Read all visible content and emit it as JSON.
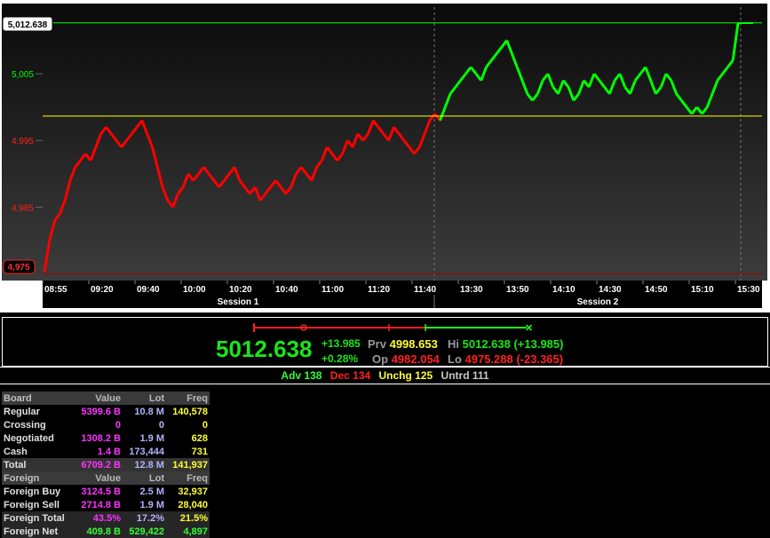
{
  "chart_data": {
    "type": "line",
    "title": "",
    "xlabel": "",
    "ylabel": "",
    "ylim": [
      4974,
      5015
    ],
    "y_ticks": [
      "5,005",
      "4,995",
      "4,985"
    ],
    "x_ticks": [
      "08:55",
      "09:20",
      "09:40",
      "10:00",
      "10:20",
      "10:40",
      "11:00",
      "11:20",
      "11:40",
      "13:30",
      "13:50",
      "14:10",
      "14:30",
      "14:50",
      "15:10",
      "15:30"
    ],
    "sessions": [
      "Session 1",
      "Session 2"
    ],
    "current_value_label": "5,012.638",
    "current_value": 5012.638,
    "low_value_label": "4,975",
    "previous_close": 4998.653,
    "previous_close_color": "#ffff00",
    "up_color": "#00ff00",
    "down_color": "#ff0000",
    "series": [
      {
        "values": [
          4975.3,
          4980,
          4983,
          4984,
          4986,
          4989,
          4991,
          4992,
          4993,
          4992,
          4994,
          4996,
          4997,
          4996,
          4995,
          4994,
          4995,
          4996,
          4997,
          4998,
          4996,
          4994,
          4991,
          4988,
          4986,
          4985,
          4987,
          4988,
          4990,
          4989,
          4990,
          4991,
          4990,
          4989,
          4988,
          4989,
          4990,
          4991,
          4989,
          4988,
          4987,
          4988,
          4986,
          4987,
          4988,
          4989,
          4988,
          4987,
          4988,
          4990,
          4991,
          4990,
          4989,
          4991,
          4992,
          4994,
          4993,
          4992,
          4993,
          4995,
          4994,
          4996,
          4995,
          4996,
          4998,
          4997,
          4996,
          4995,
          4997,
          4996,
          4995,
          4994,
          4993,
          4994,
          4996,
          4998,
          4999,
          4998,
          5000,
          5002,
          5003,
          5004,
          5005,
          5006,
          5005,
          5004,
          5006,
          5007,
          5008,
          5009,
          5010,
          5008,
          5006,
          5004,
          5002,
          5001,
          5002,
          5004,
          5005,
          5003,
          5002,
          5004,
          5003,
          5001,
          5002,
          5004,
          5003,
          5005,
          5004,
          5003,
          5002,
          5004,
          5005,
          5003,
          5002,
          5004,
          5005,
          5006,
          5004,
          5002,
          5003,
          5005,
          5004,
          5002,
          5001,
          5000,
          4999,
          5000,
          4999,
          5000,
          5002,
          5004,
          5005,
          5006,
          5007,
          5012.6
        ]
      }
    ]
  },
  "quote": {
    "last": "5012.638",
    "change": "+13.985",
    "change_pct": "+0.28%",
    "prv_label": "Prv",
    "prv": "4998.653",
    "op_label": "Op",
    "op": "4982.054",
    "hi_label": "Hi",
    "hi": "5012.638 (+13.985)",
    "lo_label": "Lo",
    "lo": "4975.288 (-23.365)"
  },
  "breadth": {
    "adv": "Adv 138",
    "dec": "Dec 134",
    "unchg": "Unchg 125",
    "untrd": "Untrd 111"
  },
  "summary": {
    "board_header": [
      "Board",
      "Value",
      "Lot",
      "Freq"
    ],
    "board_rows": [
      {
        "label": "Regular",
        "value": "5399.6 B",
        "lot": "10.8 M",
        "freq": "140,578"
      },
      {
        "label": "Crossing",
        "value": "0",
        "lot": "0",
        "freq": "0"
      },
      {
        "label": "Negotiated",
        "value": "1308.2 B",
        "lot": "1.9 M",
        "freq": "628"
      },
      {
        "label": "Cash",
        "value": "1.4 B",
        "lot": "173,444",
        "freq": "731"
      }
    ],
    "total": {
      "label": "Total",
      "value": "6709.2 B",
      "lot": "12.8 M",
      "freq": "141,937"
    },
    "foreign_header": [
      "Foreign",
      "Value",
      "Lot",
      "Freq"
    ],
    "foreign_rows": [
      {
        "label": "Foreign Buy",
        "value": "3124.5 B",
        "lot": "2.5 M",
        "freq": "32,937"
      },
      {
        "label": "Foreign Sell",
        "value": "2714.8 B",
        "lot": "1.9 M",
        "freq": "28,040"
      }
    ],
    "foreign_total": {
      "label": "Foreign Total",
      "value": "43.5%",
      "lot": "17.2%",
      "freq": "21.5%"
    },
    "foreign_net": {
      "label": "Foreign Net",
      "value": "409.8 B",
      "lot": "529,422",
      "freq": "4,897"
    }
  }
}
